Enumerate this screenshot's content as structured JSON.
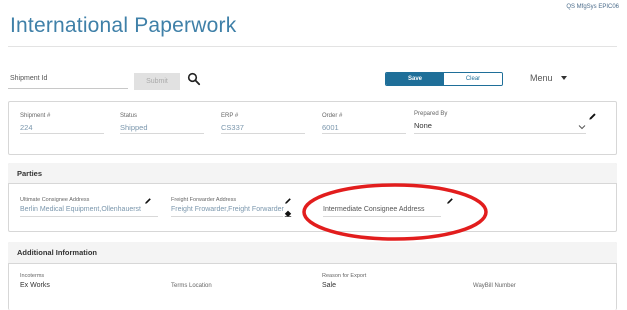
{
  "header": {
    "app_tags": "QS  MfgSys  EPIC06",
    "title": "International Paperwork"
  },
  "toolbar": {
    "shipment_id_placeholder": "Shipment Id",
    "submit_label": "Submit",
    "save_label": "Save",
    "clear_label": "Clear",
    "menu_label": "Menu"
  },
  "shipment": {
    "shipment_no_label": "Shipment #",
    "shipment_no": "224",
    "status_label": "Status",
    "status": "Shipped",
    "erp_label": "ERP #",
    "erp": "CS337",
    "order_label": "Order #",
    "order": "6001",
    "prepared_by_label": "Prepared By",
    "prepared_by": "None"
  },
  "parties": {
    "title": "Parties",
    "ultimate_label": "Ultimate Consignee Address",
    "ultimate_value": "Berlin Medical Equipment,Ollenhauerst",
    "forwarder_label": "Freight Forwarder Address",
    "forwarder_value": "Freight Frowarder,Freight Forwarder",
    "intermediate_label": "Intermediate Consignee Address"
  },
  "additional": {
    "title": "Additional Information",
    "incoterms_label": "Incoterms",
    "incoterms_value": "Ex Works",
    "terms_location_label": "Terms Location",
    "reason_label": "Reason for Export",
    "reason_value": "Sale",
    "waybill_label": "WayBill Number"
  },
  "colors": {
    "accent": "#1f6f99",
    "title": "#3f80a8",
    "annotation": "#e21d1d"
  }
}
